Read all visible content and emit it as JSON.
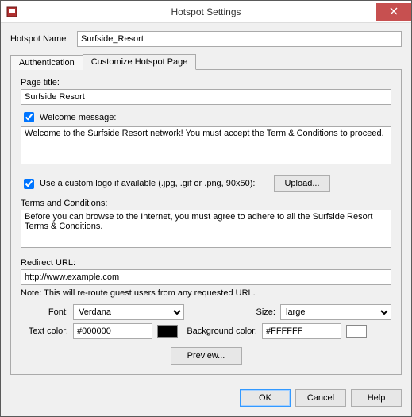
{
  "window": {
    "title": "Hotspot Settings"
  },
  "hotspot_name": {
    "label": "Hotspot Name",
    "value": "Surfside_Resort"
  },
  "tabs": {
    "authentication": "Authentication",
    "customize": "Customize Hotspot Page"
  },
  "page_title": {
    "label": "Page title:",
    "value": "Surfside Resort"
  },
  "welcome": {
    "label": "Welcome message:",
    "value": "Welcome to the Surfside Resort network! You must accept the Term & Conditions to proceed."
  },
  "custom_logo": {
    "label": "Use a custom logo if available (.jpg, .gif or .png, 90x50):",
    "upload": "Upload..."
  },
  "terms": {
    "label": "Terms and Conditions:",
    "value": "Before you can browse to the Internet, you must agree to adhere to all the Surfside Resort Terms & Conditions."
  },
  "redirect": {
    "label": "Redirect URL:",
    "value": "http://www.example.com",
    "note": "Note: This will re-route guest users from any requested URL."
  },
  "font_row": {
    "font_label": "Font:",
    "font_value": "Verdana",
    "size_label": "Size:",
    "size_value": "large"
  },
  "color_row": {
    "text_label": "Text color:",
    "text_value": "#000000",
    "text_swatch": "#000000",
    "bg_label": "Background color:",
    "bg_value": "#FFFFFF",
    "bg_swatch": "#FFFFFF"
  },
  "preview_button": "Preview...",
  "footer": {
    "ok": "OK",
    "cancel": "Cancel",
    "help": "Help"
  }
}
